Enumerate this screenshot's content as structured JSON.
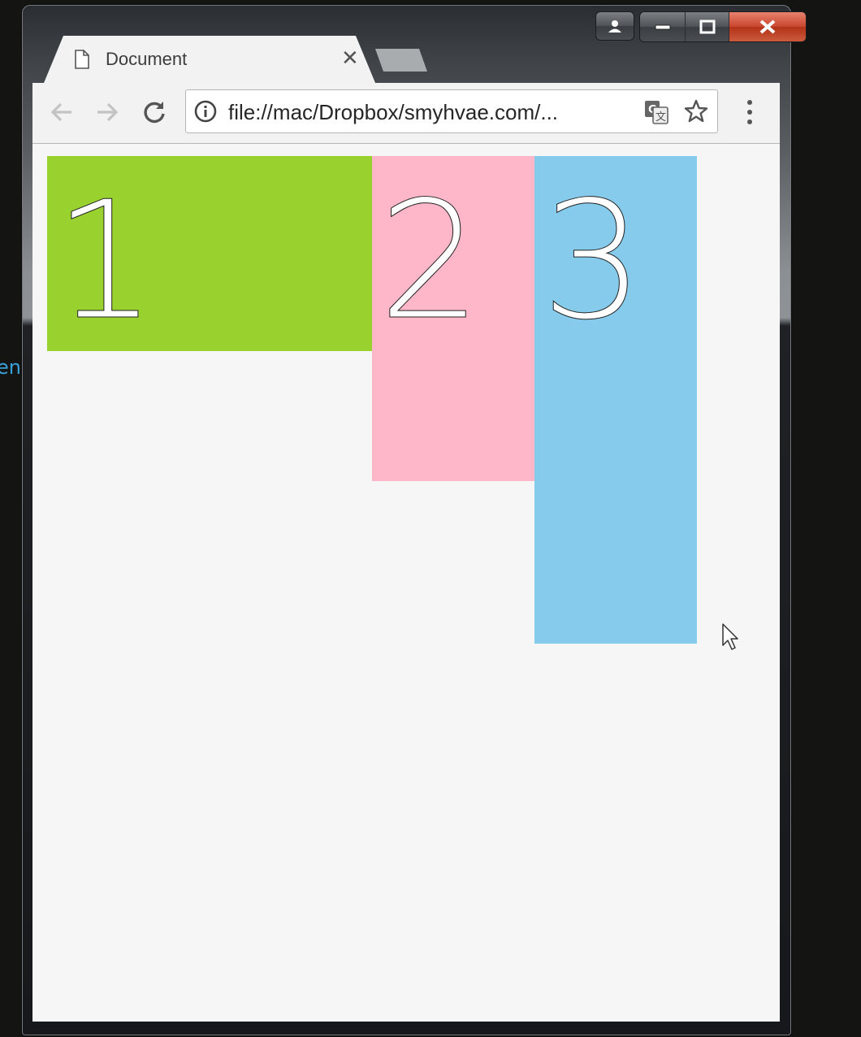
{
  "desktop": {
    "edge_text": "en"
  },
  "window": {
    "caption_buttons": [
      "profile",
      "minimize",
      "maximize",
      "close"
    ]
  },
  "tab": {
    "title": "Document",
    "close_glyph": "✕"
  },
  "address_bar": {
    "url": "file://mac/Dropbox/smyhvae.com/..."
  },
  "page": {
    "boxes": [
      {
        "label": "1",
        "color": "#99d12f"
      },
      {
        "label": "2",
        "color": "#feb7c8"
      },
      {
        "label": "3",
        "color": "#86cbeb"
      }
    ]
  },
  "icons": {
    "back": "arrow-left-icon",
    "forward": "arrow-right-icon",
    "reload": "reload-icon",
    "info": "info-icon",
    "translate": "translate-icon",
    "bookmark": "star-icon",
    "menu": "kebab-menu-icon"
  }
}
